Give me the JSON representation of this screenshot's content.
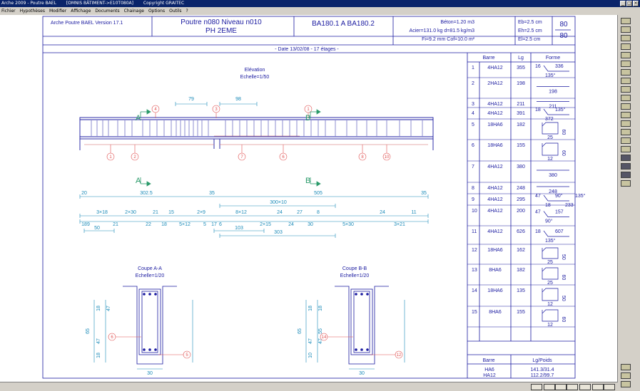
{
  "window": {
    "app_title": "Arche 2009 - Poutre BAEL",
    "document_title": "[OMNIS BÂTIMENT->E10T080A]",
    "copyright": "Copyright GRAITEC"
  },
  "menu": [
    "Fichier",
    "Hypothèses",
    "Modifier",
    "Affichage",
    "Documents",
    "Chainage",
    "Options",
    "Outils",
    "?"
  ],
  "header": {
    "software": "Arche Poutre BAEL Version 17.1",
    "beam_title": "Poutre n080 Niveau n010",
    "beam_subtitle": "PH 2EME",
    "reference": "BA180.1 A BA180.2",
    "beton": "Béton=1.20 m3",
    "acier": "Acier=131.0 kg d=81.5 kg/m3",
    "fi": "Fi=9.2 mm Cof=10.0 m²",
    "eb": "Eb=2.5 cm",
    "eh": "Eh=2.5 cm",
    "el": "El=2.5 cm",
    "count_top": "80",
    "count_bottom": "80",
    "date_line": "- Date 13/02/08 - 17 étages -"
  },
  "elevation": {
    "title": "Elévation",
    "scale": "Echelle=1/50",
    "dim_79": "79",
    "dim_98": "98",
    "sec_a": "A",
    "sec_b": "B",
    "marks_top": [
      "4",
      "3",
      "1"
    ],
    "marks_bottom": [
      "1",
      "2",
      "7",
      "6",
      "8",
      "10"
    ],
    "row1": [
      "20",
      "302.5",
      "35",
      "505",
      "35"
    ],
    "row2_left": [
      "3×18",
      "2×30",
      "21",
      "15",
      "2×9"
    ],
    "row2_right": [
      "300×10",
      "8×12",
      "24",
      "27",
      "8",
      "24",
      "11"
    ],
    "row3": [
      "18",
      "9",
      "21",
      "22",
      "18",
      "5×12",
      "5",
      "17",
      "6",
      "2×15",
      "24",
      "30",
      "5×30",
      "3×21"
    ],
    "row4": [
      "50",
      "103",
      "303"
    ]
  },
  "coupe_a": {
    "title": "Coupe A-A",
    "scale": "Echelle=1/20",
    "dims": [
      "18",
      "65",
      "47",
      "18",
      "47",
      "30"
    ],
    "marks": [
      "6",
      "5"
    ]
  },
  "coupe_b": {
    "title": "Coupe B-B",
    "scale": "Echelle=1/20",
    "dims": [
      "18",
      "65",
      "47",
      "10",
      "18",
      "55",
      "47",
      "30"
    ],
    "marks": [
      "14",
      "12"
    ]
  },
  "table": {
    "headers": [
      "Barre",
      "Lg",
      "Forme"
    ],
    "rows": [
      {
        "n": "1",
        "barre": "4HA12",
        "lg": "355",
        "forme": [
          "16",
          "135°",
          "336"
        ]
      },
      {
        "n": "2",
        "barre": "2HA12",
        "lg": "198",
        "forme": [
          "198"
        ]
      },
      {
        "n": "3",
        "barre": "4HA12",
        "lg": "211",
        "forme": [
          "211"
        ]
      },
      {
        "n": "4",
        "barre": "4HA12",
        "lg": "391",
        "forme": [
          "18",
          "372",
          "135°"
        ]
      },
      {
        "n": "5",
        "barre": "18HA6",
        "lg": "182",
        "forme": [
          "60",
          "25"
        ]
      },
      {
        "n": "6",
        "barre": "18HA6",
        "lg": "155",
        "forme": [
          "60",
          "12"
        ]
      },
      {
        "n": "7",
        "barre": "4HA12",
        "lg": "380",
        "forme": [
          "380"
        ]
      },
      {
        "n": "8",
        "barre": "4HA12",
        "lg": "248",
        "forme": [
          "248"
        ]
      },
      {
        "n": "9",
        "barre": "4HA12",
        "lg": "295",
        "forme": [
          "47",
          "18",
          "90°",
          "233",
          "135°"
        ]
      },
      {
        "n": "10",
        "barre": "4HA12",
        "lg": "200",
        "forme": [
          "47",
          "90°",
          "157"
        ]
      },
      {
        "n": "11",
        "barre": "4HA12",
        "lg": "626",
        "forme": [
          "18",
          "135°",
          "607"
        ]
      },
      {
        "n": "12",
        "barre": "18HA6",
        "lg": "162",
        "forme": [
          "50",
          "25"
        ]
      },
      {
        "n": "13",
        "barre": "8HA6",
        "lg": "182",
        "forme": [
          "60",
          "25"
        ]
      },
      {
        "n": "14",
        "barre": "18HA6",
        "lg": "135",
        "forme": [
          "50",
          "12"
        ]
      },
      {
        "n": "15",
        "barre": "8HA6",
        "lg": "155",
        "forme": [
          "60",
          "12"
        ]
      }
    ],
    "summary_headers": [
      "Barre",
      "Lg/Poids"
    ],
    "summary": [
      {
        "barre": "HA6",
        "lg": "141.3/31.4"
      },
      {
        "barre": "HA12",
        "lg": "112.2/99.7"
      }
    ]
  },
  "colors": {
    "drawing": "#1a1aa0",
    "dims": "#1a8ab8",
    "marks": "#e05050",
    "section": "#2a9a6a"
  }
}
